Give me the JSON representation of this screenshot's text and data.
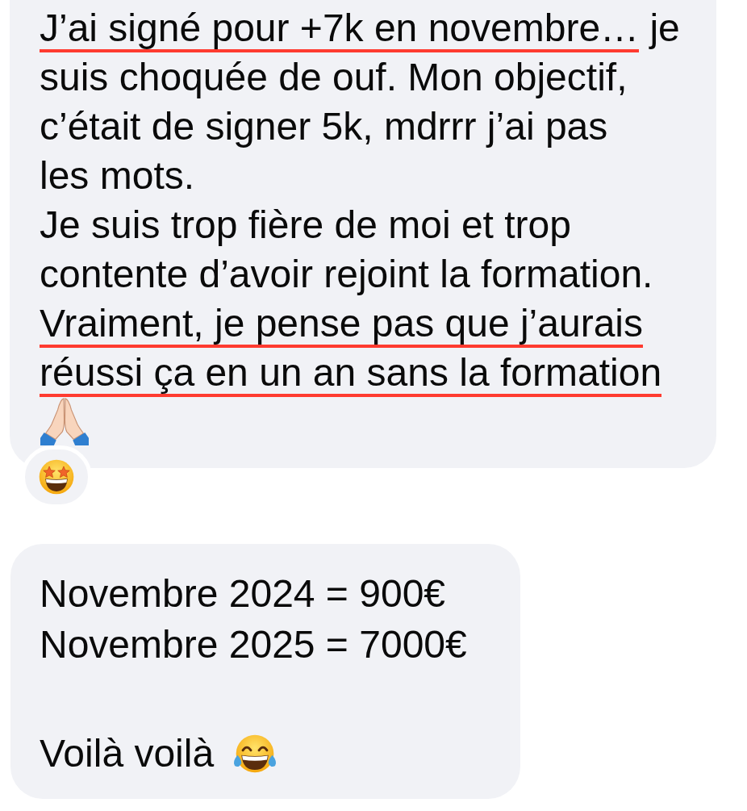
{
  "messages": [
    {
      "kind": "stacked",
      "reaction": true,
      "paragraphs": [
        {
          "lines": [
            [
              {
                "text": "J’ai signé pour +7k en novembre…",
                "underlined": true
              },
              {
                "text": " je",
                "underlined": false
              }
            ],
            [
              {
                "text": "suis choquée de ouf. Mon objectif,",
                "underlined": false
              }
            ],
            [
              {
                "text": "c’était de signer 5k, mdrrr j’ai pas",
                "underlined": false
              }
            ],
            [
              {
                "text": "les mots.",
                "underlined": false
              }
            ]
          ]
        },
        {
          "lines": [
            [
              {
                "text": "Je suis trop fière de moi et trop",
                "underlined": false
              }
            ],
            [
              {
                "text": "contente d’avoir rejoint la formation.",
                "underlined": false
              }
            ],
            [
              {
                "text": "Vraiment, je pense pas que j’aurais",
                "underlined": true
              }
            ],
            [
              {
                "text": "réussi ça en un an sans la formation",
                "underlined": true
              }
            ]
          ]
        }
      ]
    },
    {
      "kind": "inline",
      "reaction": false,
      "paragraphs": [
        {
          "lines": [
            [
              {
                "text": "Novembre 2024 = 900€",
                "underlined": false
              }
            ],
            [
              {
                "text": "Novembre 2025 = 7000€",
                "underlined": false
              }
            ]
          ]
        },
        {
          "lines": [
            [
              {
                "text": "Voilà voilà",
                "underlined": false
              }
            ]
          ]
        }
      ]
    }
  ]
}
